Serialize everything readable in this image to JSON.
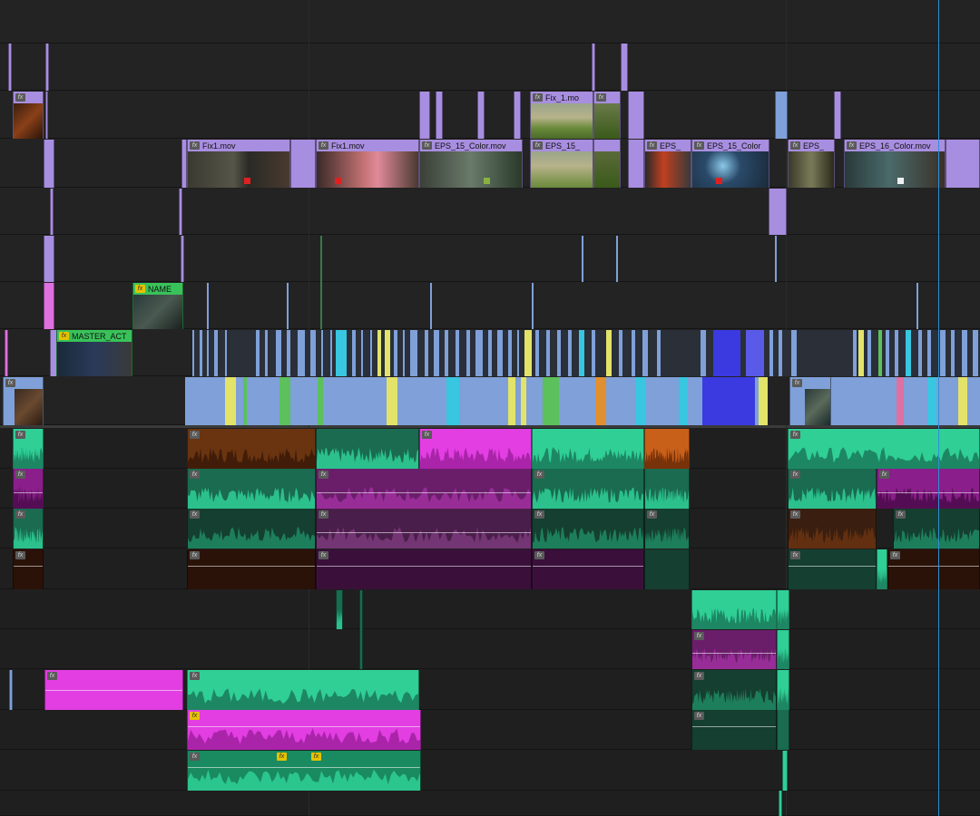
{
  "app": {
    "panel": "timeline-sequence",
    "playhead_color": "#2f8fd6"
  },
  "colors": {
    "video_clip": "#a88ee0",
    "video_clip_selected": "#b59cf0",
    "cut_blue": "#7fa0d8",
    "cut_cyan": "#38c6e0",
    "cut_yellow": "#e3e36a",
    "cut_green": "#5cc05c",
    "cut_orange": "#e09030",
    "cut_deep_blue": "#3a3ae0",
    "nest_green": "#39c25a",
    "audio_teal": "#2fcf96",
    "audio_teal_dark": "#1a6b50",
    "audio_magenta": "#e23ee2",
    "audio_purple_dark": "#5a1e6a",
    "audio_brown": "#6a3410",
    "audio_orange": "#c8601a"
  },
  "icons": {
    "fx_badge": "fx-badge-icon",
    "marker_red": "marker-red-icon",
    "marker_green": "marker-green-icon",
    "marker_white": "marker-white-icon"
  },
  "clips": {
    "fix1_a": "Fix1.mov",
    "fix1_b": "Fix1.mov",
    "fix1_c": "Fix_1.mo",
    "eps15_a": "EPS_15_Color.mov",
    "eps15_b": "EPS_15_",
    "eps15_c": "EPS_",
    "eps15_d": "EPS_15_Color",
    "eps15_e": "EPS_",
    "eps16": "EPS_16_Color.mov",
    "name": "NAME",
    "master": "MASTER_ACT"
  },
  "fx_label": "fx"
}
